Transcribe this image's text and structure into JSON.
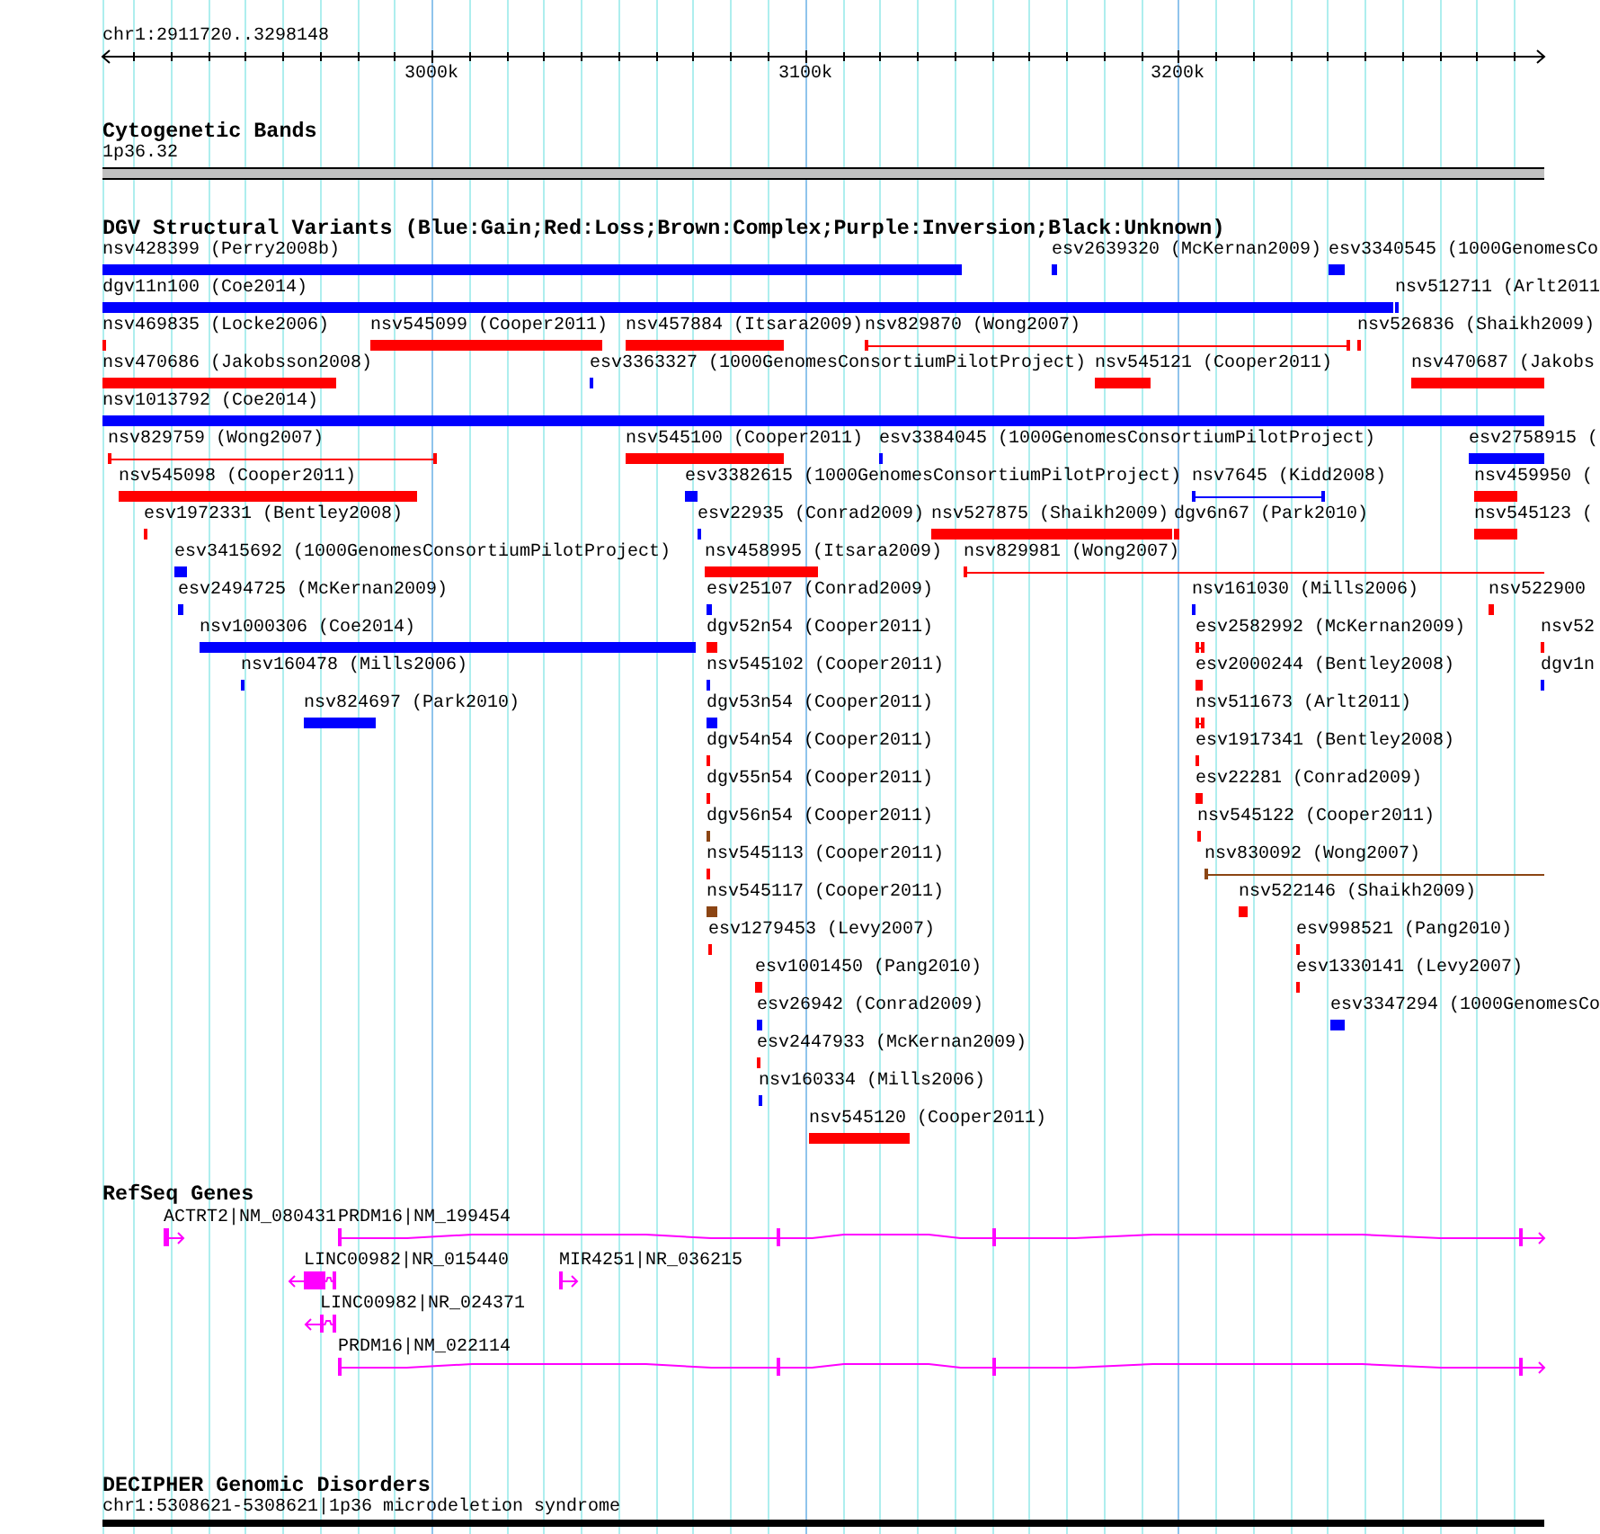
{
  "ruler": {
    "location": "chr1:2911720..3298148",
    "ticks": [
      "3000k",
      "3100k",
      "3200k"
    ]
  },
  "tracks": [
    {
      "kind": "bands",
      "title": "Cytogenetic Bands",
      "rows": [
        {
          "features": [
            {
              "label": "1p36.32"
            }
          ]
        }
      ]
    },
    {
      "kind": "variants",
      "title": "DGV Structural Variants (Blue:Gain;Red:Loss;Brown:Complex;Purple:Inversion;Black:Unknown)",
      "rows": [
        {
          "features": [
            {
              "label": "nsv428399 (Perry2008b)",
              "kind": "box",
              "color": "#0000ff"
            },
            {
              "label": "esv2639320 (McKernan2009)",
              "kind": "box",
              "color": "#0000ff"
            },
            {
              "label": "esv3340545 (1000GenomesCo",
              "kind": "box",
              "color": "#0000ff"
            }
          ]
        },
        {
          "features": [
            {
              "label": "dgv11n100 (Coe2014)",
              "kind": "box",
              "color": "#0000ff"
            },
            {
              "label": "nsv512711 (Arlt2011",
              "kind": "box",
              "color": "#0000ff"
            }
          ]
        },
        {
          "features": [
            {
              "label": "nsv469835 (Locke2006)",
              "kind": "box",
              "color": "#ff0000"
            },
            {
              "label": "nsv545099 (Cooper2011)",
              "kind": "box",
              "color": "#ff0000"
            },
            {
              "label": "nsv457884 (Itsara2009)",
              "kind": "box",
              "color": "#ff0000"
            },
            {
              "label": "nsv829870 (Wong2007)",
              "kind": "line",
              "color": "#ff0000"
            },
            {
              "label": "nsv526836 (Shaikh2009)",
              "kind": "box",
              "color": "#ff0000"
            }
          ]
        },
        {
          "features": [
            {
              "label": "nsv470686 (Jakobsson2008)",
              "kind": "box",
              "color": "#ff0000"
            },
            {
              "label": "esv3363327 (1000GenomesConsortiumPilotProject)",
              "kind": "box",
              "color": "#0000ff"
            },
            {
              "label": "nsv545121 (Cooper2011)",
              "kind": "box",
              "color": "#ff0000"
            },
            {
              "label": "nsv470687 (Jakobs",
              "kind": "box",
              "color": "#ff0000"
            }
          ]
        },
        {
          "features": [
            {
              "label": "nsv1013792 (Coe2014)",
              "kind": "box",
              "color": "#0000ff"
            }
          ]
        },
        {
          "features": [
            {
              "label": "nsv829759 (Wong2007)",
              "kind": "line",
              "color": "#ff0000"
            },
            {
              "label": "nsv545100 (Cooper2011)",
              "kind": "box",
              "color": "#ff0000"
            },
            {
              "label": "esv3384045 (1000GenomesConsortiumPilotProject)",
              "kind": "box",
              "color": "#0000ff"
            },
            {
              "label": "esv2758915 (",
              "kind": "box",
              "color": "#0000ff"
            }
          ]
        },
        {
          "features": [
            {
              "label": "nsv545098 (Cooper2011)",
              "kind": "box",
              "color": "#ff0000"
            },
            {
              "label": "esv3382615 (1000GenomesConsortiumPilotProject)",
              "kind": "box",
              "color": "#0000ff"
            },
            {
              "label": "nsv7645 (Kidd2008)",
              "kind": "line",
              "color": "#0000ff"
            },
            {
              "label": "nsv459950 (",
              "kind": "box",
              "color": "#ff0000"
            }
          ]
        },
        {
          "features": [
            {
              "label": "esv1972331 (Bentley2008)",
              "kind": "box",
              "color": "#ff0000"
            },
            {
              "label": "esv22935 (Conrad2009)",
              "kind": "box",
              "color": "#0000ff"
            },
            {
              "label": "nsv527875 (Shaikh2009)",
              "kind": "box",
              "color": "#ff0000"
            },
            {
              "label": "dgv6n67 (Park2010)",
              "kind": "box",
              "color": "#ff0000"
            },
            {
              "label": "nsv545123 (",
              "kind": "box",
              "color": "#ff0000"
            }
          ]
        },
        {
          "features": [
            {
              "label": "esv3415692 (1000GenomesConsortiumPilotProject)",
              "kind": "box",
              "color": "#0000ff"
            },
            {
              "label": "nsv458995 (Itsara2009)",
              "kind": "box",
              "color": "#ff0000"
            },
            {
              "label": "nsv829981 (Wong2007)",
              "kind": "line",
              "color": "#ff0000"
            }
          ]
        },
        {
          "features": [
            {
              "label": "esv2494725 (McKernan2009)",
              "kind": "box",
              "color": "#0000ff"
            },
            {
              "label": "esv25107 (Conrad2009)",
              "kind": "box",
              "color": "#0000ff"
            },
            {
              "label": "nsv161030 (Mills2006)",
              "kind": "box",
              "color": "#0000ff"
            },
            {
              "label": "nsv522900",
              "kind": "box",
              "color": "#ff0000"
            }
          ]
        },
        {
          "features": [
            {
              "label": "nsv1000306 (Coe2014)",
              "kind": "box",
              "color": "#0000ff"
            },
            {
              "label": "dgv52n54 (Cooper2011)",
              "kind": "box",
              "color": "#ff0000"
            },
            {
              "label": "esv2582992 (McKernan2009)",
              "kind": "line",
              "color": "#ff0000"
            },
            {
              "label": "nsv52",
              "kind": "box",
              "color": "#ff0000"
            }
          ]
        },
        {
          "features": [
            {
              "label": "nsv160478 (Mills2006)",
              "kind": "box",
              "color": "#0000ff"
            },
            {
              "label": "nsv545102 (Cooper2011)",
              "kind": "box",
              "color": "#0000ff"
            },
            {
              "label": "esv2000244 (Bentley2008)",
              "kind": "box",
              "color": "#ff0000"
            },
            {
              "label": "dgv1n",
              "kind": "box",
              "color": "#0000ff"
            }
          ]
        },
        {
          "features": [
            {
              "label": "nsv824697 (Park2010)",
              "kind": "box",
              "color": "#0000ff"
            },
            {
              "label": "dgv53n54 (Cooper2011)",
              "kind": "box",
              "color": "#0000ff"
            },
            {
              "label": "nsv511673 (Arlt2011)",
              "kind": "line",
              "color": "#ff0000"
            }
          ]
        },
        {
          "features": [
            {
              "label": "dgv54n54 (Cooper2011)",
              "kind": "box",
              "color": "#ff0000"
            },
            {
              "label": "esv1917341 (Bentley2008)",
              "kind": "box",
              "color": "#ff0000"
            }
          ]
        },
        {
          "features": [
            {
              "label": "dgv55n54 (Cooper2011)",
              "kind": "box",
              "color": "#ff0000"
            },
            {
              "label": "esv22281 (Conrad2009)",
              "kind": "box",
              "color": "#ff0000"
            }
          ]
        },
        {
          "features": [
            {
              "label": "dgv56n54 (Cooper2011)",
              "kind": "box",
              "color": "#8b4513"
            },
            {
              "label": "nsv545122 (Cooper2011)",
              "kind": "box",
              "color": "#ff0000"
            }
          ]
        },
        {
          "features": [
            {
              "label": "nsv545113 (Cooper2011)",
              "kind": "box",
              "color": "#ff0000"
            },
            {
              "label": "nsv830092 (Wong2007)",
              "kind": "line",
              "color": "#8b4513"
            }
          ]
        },
        {
          "features": [
            {
              "label": "nsv545117 (Cooper2011)",
              "kind": "box",
              "color": "#8b4513"
            },
            {
              "label": "nsv522146 (Shaikh2009)",
              "kind": "box",
              "color": "#ff0000"
            }
          ]
        },
        {
          "features": [
            {
              "label": "esv1279453 (Levy2007)",
              "kind": "box",
              "color": "#ff0000"
            },
            {
              "label": "esv998521 (Pang2010)",
              "kind": "box",
              "color": "#ff0000"
            }
          ]
        },
        {
          "features": [
            {
              "label": "esv1001450 (Pang2010)",
              "kind": "box",
              "color": "#ff0000"
            },
            {
              "label": "esv1330141 (Levy2007)",
              "kind": "box",
              "color": "#ff0000"
            }
          ]
        },
        {
          "features": [
            {
              "label": "esv26942 (Conrad2009)",
              "kind": "box",
              "color": "#0000ff"
            },
            {
              "label": "esv3347294 (1000GenomesCo",
              "kind": "box",
              "color": "#0000ff"
            }
          ]
        },
        {
          "features": [
            {
              "label": "esv2447933 (McKernan2009)",
              "kind": "box",
              "color": "#ff0000"
            }
          ]
        },
        {
          "features": [
            {
              "label": "nsv160334 (Mills2006)",
              "kind": "box",
              "color": "#0000ff"
            }
          ]
        },
        {
          "features": [
            {
              "label": "nsv545120 (Cooper2011)",
              "kind": "box",
              "color": "#ff0000"
            }
          ]
        }
      ]
    },
    {
      "kind": "genes",
      "title": "RefSeq Genes",
      "rows": [
        {
          "features": [
            {
              "label": "ACTRT2|NM_080431",
              "reverse": false
            },
            {
              "label": "PRDM16|NM_199454",
              "reverse": false
            }
          ]
        },
        {
          "features": [
            {
              "label": "LINC00982|NR_015440",
              "reverse": true
            },
            {
              "label": "MIR4251|NR_036215",
              "reverse": false
            }
          ]
        },
        {
          "features": [
            {
              "label": "LINC00982|NR_024371",
              "reverse": true
            }
          ]
        },
        {
          "features": [
            {
              "label": "PRDM16|NM_022114",
              "reverse": false
            }
          ]
        }
      ]
    },
    {
      "kind": "disorders",
      "title": "DECIPHER Genomic Disorders",
      "rows": [
        {
          "features": [
            {
              "label": "chr1:5308621-5308621|1p36 microdeletion syndrome"
            }
          ]
        }
      ]
    }
  ]
}
